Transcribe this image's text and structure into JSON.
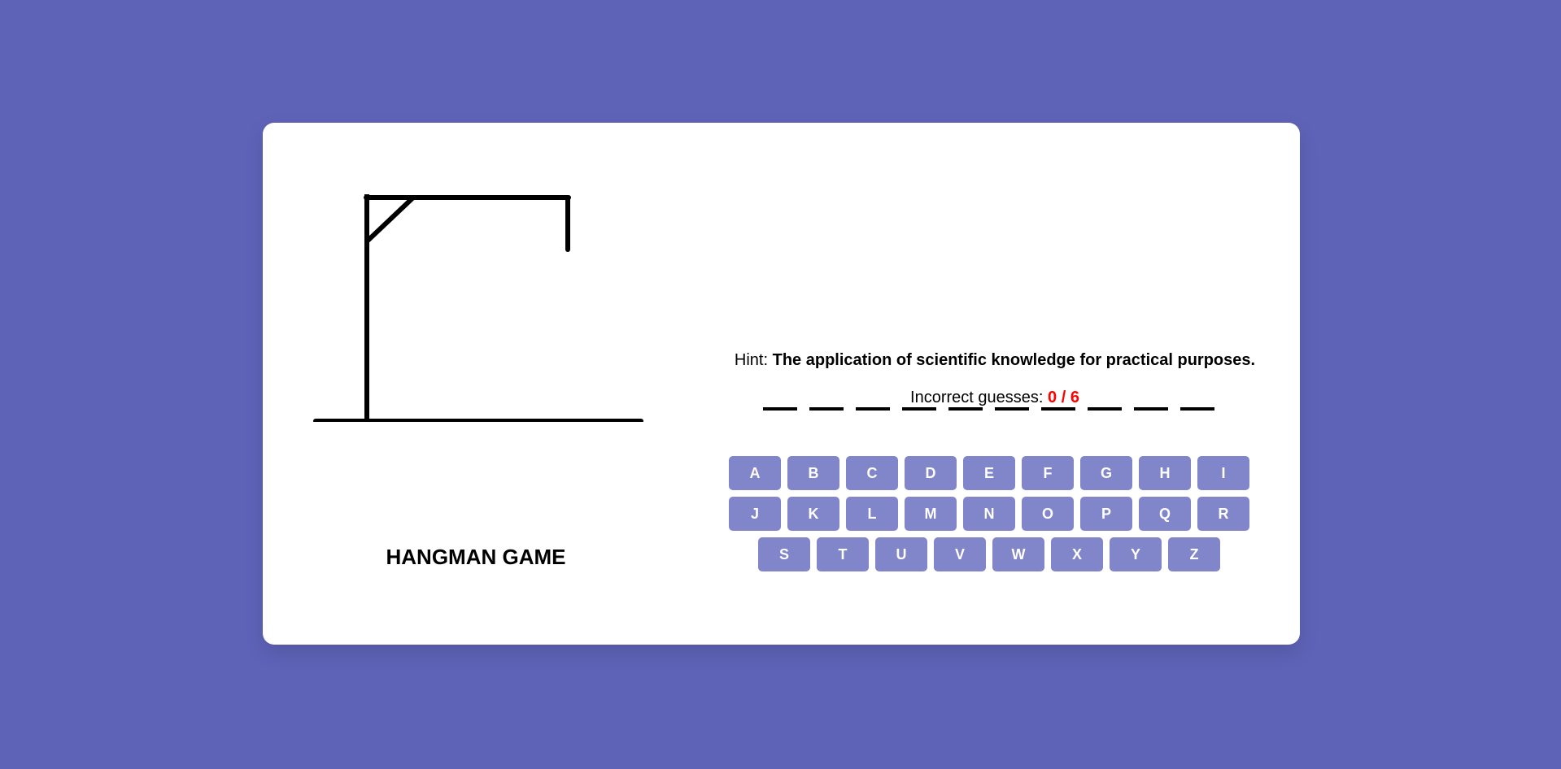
{
  "game": {
    "title": "HANGMAN GAME",
    "word_length": 10,
    "hint_label": "Hint:",
    "hint_text": "The application of scientific knowledge for practical purposes.",
    "guesses_label": "Incorrect guesses:",
    "guesses_count": "0 / 6"
  },
  "keyboard": {
    "rows": [
      [
        "A",
        "B",
        "C",
        "D",
        "E",
        "F",
        "G",
        "H",
        "I"
      ],
      [
        "J",
        "K",
        "L",
        "M",
        "N",
        "O",
        "P",
        "Q",
        "R"
      ],
      [
        "S",
        "T",
        "U",
        "V",
        "W",
        "X",
        "Y",
        "Z"
      ]
    ]
  },
  "colors": {
    "background": "#5e63b8",
    "card": "#ffffff",
    "key": "#8185ca",
    "guesses_count": "#ff0000"
  }
}
